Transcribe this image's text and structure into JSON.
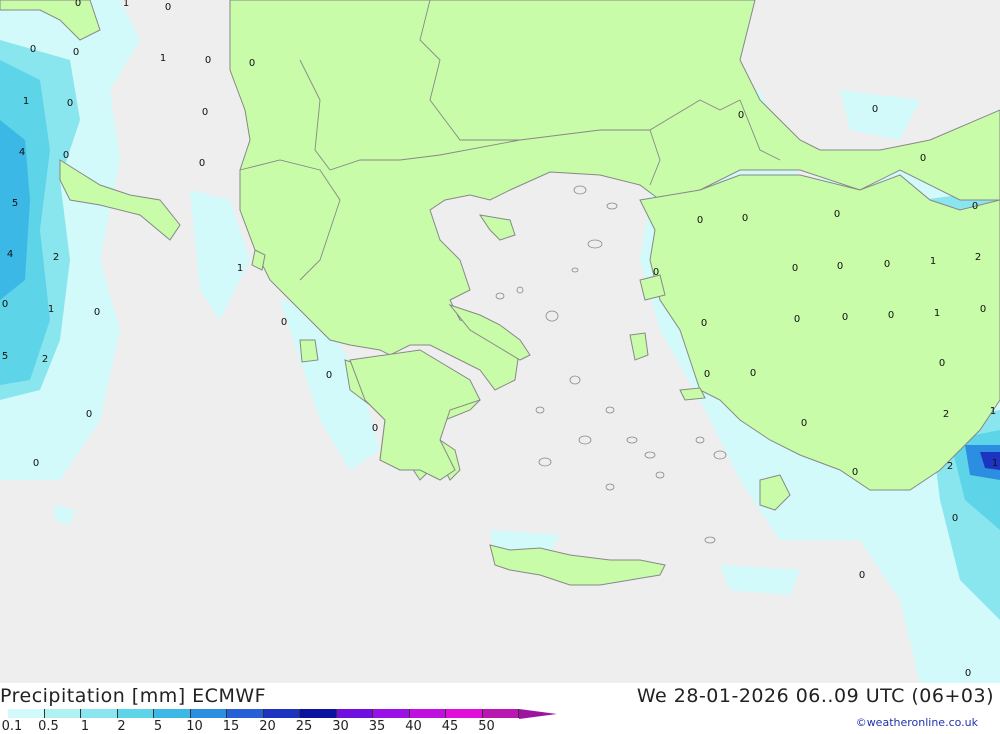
{
  "header": {
    "title": "Precipitation [mm] ECMWF",
    "datetime": "We 28-01-2026 06..09 UTC (06+03)",
    "credit": "©weatheronline.co.uk"
  },
  "legend": {
    "swatches": [
      {
        "label": "0.1",
        "color": "#d2fafa"
      },
      {
        "label": "0.5",
        "color": "#b0f2f2"
      },
      {
        "label": "1",
        "color": "#8ae6ee"
      },
      {
        "label": "2",
        "color": "#5ed4e8"
      },
      {
        "label": "5",
        "color": "#3cb8e6"
      },
      {
        "label": "10",
        "color": "#2c8ee0"
      },
      {
        "label": "15",
        "color": "#2660d8"
      },
      {
        "label": "20",
        "color": "#1c34c0"
      },
      {
        "label": "25",
        "color": "#0c12a0"
      },
      {
        "label": "30",
        "color": "#7010e0"
      },
      {
        "label": "35",
        "color": "#9a10e6"
      },
      {
        "label": "40",
        "color": "#c010e0"
      },
      {
        "label": "45",
        "color": "#e010d8"
      },
      {
        "label": "50",
        "color": "#b818b0"
      }
    ]
  },
  "map": {
    "colors": {
      "sea": "#eeeeee",
      "land": "#c8fca8",
      "border": "#888888"
    },
    "values": [
      "0",
      "1",
      "0",
      "0",
      "1",
      "0",
      "0",
      "0",
      "0",
      "0",
      "4",
      "0",
      "1",
      "0",
      "5",
      "1",
      "4",
      "2",
      "0",
      "0",
      "5",
      "1",
      "0",
      "0",
      "2",
      "0",
      "0",
      "0",
      "0",
      "0",
      "0",
      "0",
      "0",
      "0",
      "0",
      "0",
      "0",
      "0",
      "0",
      "1",
      "2",
      "0",
      "0",
      "0",
      "0",
      "1",
      "0",
      "0",
      "0",
      "0",
      "2",
      "1",
      "0",
      "2",
      "1",
      "0",
      "0",
      "0",
      "0"
    ]
  }
}
